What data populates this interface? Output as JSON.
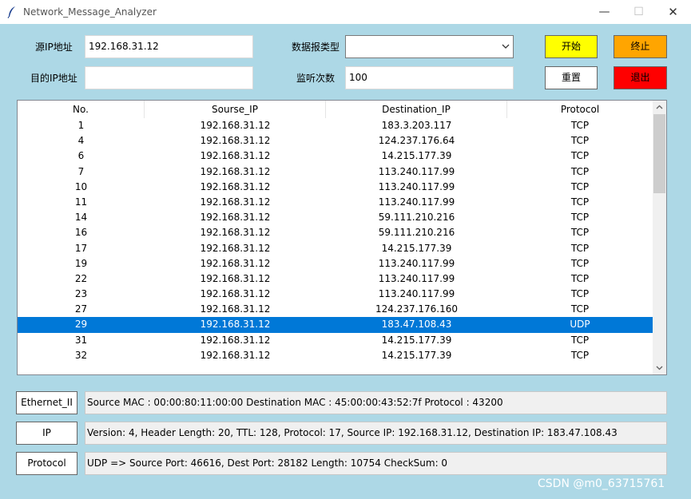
{
  "window": {
    "title": "Network_Message_Analyzer",
    "min_glyph": "—",
    "max_glyph": "☐",
    "close_glyph": "✕",
    "icon": "feather-icon"
  },
  "form": {
    "src_ip_label": "源IP地址",
    "src_ip_value": "192.168.31.12",
    "dst_ip_label": "目的IP地址",
    "dst_ip_value": "",
    "packet_type_label": "数据报类型",
    "packet_type_value": "",
    "listen_count_label": "监听次数",
    "listen_count_value": "100"
  },
  "buttons": {
    "start": {
      "label": "开始",
      "color": "#ffff00"
    },
    "stop": {
      "label": "终止",
      "color": "#ffa500"
    },
    "reset": {
      "label": "重置",
      "color": "#ffffff"
    },
    "exit": {
      "label": "退出",
      "color": "#ff0000"
    }
  },
  "table": {
    "columns": [
      "No.",
      "Sourse_IP",
      "Destination_IP",
      "Protocol"
    ],
    "selected_color": "#0078d7",
    "rows": [
      {
        "no": "1",
        "src": "192.168.31.12",
        "dst": "183.3.203.117",
        "proto": "TCP"
      },
      {
        "no": "4",
        "src": "192.168.31.12",
        "dst": "124.237.176.64",
        "proto": "TCP"
      },
      {
        "no": "6",
        "src": "192.168.31.12",
        "dst": "14.215.177.39",
        "proto": "TCP"
      },
      {
        "no": "7",
        "src": "192.168.31.12",
        "dst": "113.240.117.99",
        "proto": "TCP"
      },
      {
        "no": "10",
        "src": "192.168.31.12",
        "dst": "113.240.117.99",
        "proto": "TCP"
      },
      {
        "no": "11",
        "src": "192.168.31.12",
        "dst": "113.240.117.99",
        "proto": "TCP"
      },
      {
        "no": "14",
        "src": "192.168.31.12",
        "dst": "59.111.210.216",
        "proto": "TCP"
      },
      {
        "no": "16",
        "src": "192.168.31.12",
        "dst": "59.111.210.216",
        "proto": "TCP"
      },
      {
        "no": "17",
        "src": "192.168.31.12",
        "dst": "14.215.177.39",
        "proto": "TCP"
      },
      {
        "no": "19",
        "src": "192.168.31.12",
        "dst": "113.240.117.99",
        "proto": "TCP"
      },
      {
        "no": "22",
        "src": "192.168.31.12",
        "dst": "113.240.117.99",
        "proto": "TCP"
      },
      {
        "no": "23",
        "src": "192.168.31.12",
        "dst": "113.240.117.99",
        "proto": "TCP"
      },
      {
        "no": "27",
        "src": "192.168.31.12",
        "dst": "124.237.176.160",
        "proto": "TCP"
      },
      {
        "no": "29",
        "src": "192.168.31.12",
        "dst": "183.47.108.43",
        "proto": "UDP",
        "selected": true
      },
      {
        "no": "31",
        "src": "192.168.31.12",
        "dst": "14.215.177.39",
        "proto": "TCP"
      },
      {
        "no": "32",
        "src": "192.168.31.12",
        "dst": "14.215.177.39",
        "proto": "TCP"
      }
    ]
  },
  "details": {
    "ethernet_label": "Ethernet_II",
    "ethernet_text": "Source MAC : 00:00:80:11:00:00 Destination MAC : 45:00:00:43:52:7f Protocol : 43200",
    "ip_label": "IP",
    "ip_text": "Version: 4, Header Length: 20, TTL: 128, Protocol: 17, Source IP: 192.168.31.12, Destination IP: 183.47.108.43",
    "protocol_label": "Protocol",
    "protocol_text": "UDP => Source Port: 46616, Dest Port: 28182 Length: 10754 CheckSum: 0"
  },
  "watermark": "CSDN @m0_63715761"
}
